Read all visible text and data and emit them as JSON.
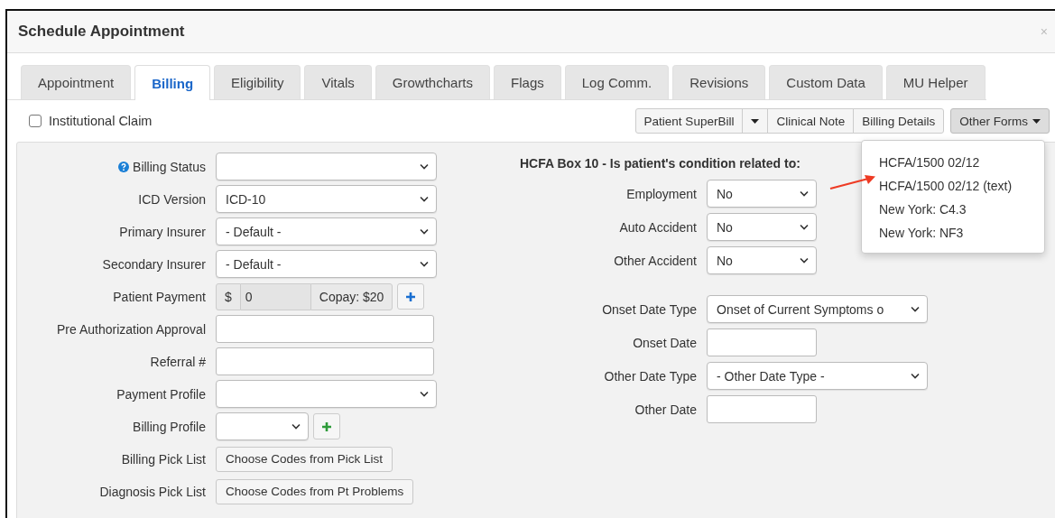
{
  "window": {
    "title": "Schedule Appointment",
    "close": "×"
  },
  "tabs": [
    {
      "label": "Appointment",
      "selected": false
    },
    {
      "label": "Billing",
      "selected": true
    },
    {
      "label": "Eligibility",
      "selected": false
    },
    {
      "label": "Vitals",
      "selected": false
    },
    {
      "label": "Growthcharts",
      "selected": false
    },
    {
      "label": "Flags",
      "selected": false
    },
    {
      "label": "Log Comm.",
      "selected": false
    },
    {
      "label": "Revisions",
      "selected": false
    },
    {
      "label": "Custom Data",
      "selected": false
    },
    {
      "label": "MU Helper",
      "selected": false
    }
  ],
  "institutional_claim": {
    "label": "Institutional Claim",
    "checked": false
  },
  "toolbar": {
    "buttons": [
      "Patient SuperBill",
      "Clinical Note",
      "Billing Details"
    ],
    "other_forms": {
      "label": "Other Forms",
      "expanded": true,
      "items": [
        "HCFA/1500 02/12",
        "HCFA/1500 02/12 (text)",
        "New York: C4.3",
        "New York: NF3"
      ]
    }
  },
  "billing_fields": [
    {
      "kind": "select",
      "label": "Billing Status",
      "help": true
    },
    {
      "kind": "select",
      "label": "ICD Version",
      "value": "ICD-10"
    },
    {
      "kind": "select",
      "label": "Primary Insurer",
      "value": "- Default -"
    },
    {
      "kind": "select",
      "label": "Secondary Insurer",
      "value": "- Default -"
    },
    {
      "kind": "payment",
      "label": "Patient Payment",
      "prefix": "$",
      "value": "0",
      "suffix": "Copay: $20"
    },
    {
      "kind": "input",
      "label": "Pre Authorization Approval"
    },
    {
      "kind": "input",
      "label": "Referral #"
    },
    {
      "kind": "select",
      "label": "Payment Profile"
    },
    {
      "kind": "selectadd",
      "label": "Billing Profile"
    },
    {
      "kind": "button",
      "label": "Billing Pick List",
      "value": "Choose Codes from Pick List"
    },
    {
      "kind": "button",
      "label": "Diagnosis Pick List",
      "value": "Choose Codes from Pt Problems"
    }
  ],
  "hcfa_box10": {
    "heading": "HCFA Box 10 - Is patient's condition related to:",
    "condition_fields": [
      {
        "kind": "select",
        "label": "Employment",
        "value": "No"
      },
      {
        "kind": "select",
        "label": "Auto Accident",
        "value": "No"
      },
      {
        "kind": "select",
        "label": "Other Accident",
        "value": "No"
      }
    ],
    "date_fields": [
      {
        "kind": "wideselect",
        "label": "Onset Date Type",
        "value": "Onset of Current Symptoms o"
      },
      {
        "kind": "date",
        "label": "Onset Date"
      },
      {
        "kind": "wideselect",
        "label": "Other Date Type",
        "value": "- Other Date Type -"
      },
      {
        "kind": "date",
        "label": "Other Date"
      }
    ]
  }
}
